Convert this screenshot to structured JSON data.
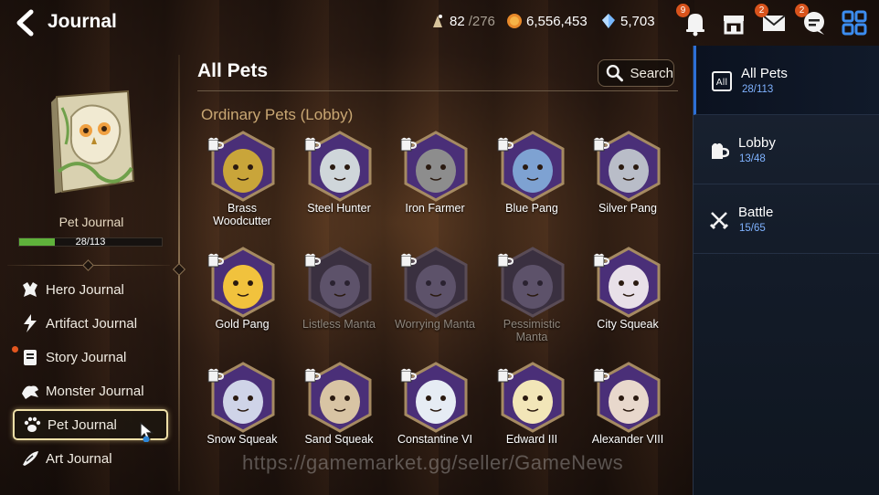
{
  "header": {
    "title": "Journal",
    "stamina": {
      "current": "82",
      "max": "/276"
    },
    "gold": "6,556,453",
    "crystals": "5,703",
    "notifications_badge": "9",
    "mail_badge": "2",
    "chat_badge": "2"
  },
  "left": {
    "book_label": "Pet Journal",
    "progress_text": "28/113",
    "progress_fraction": 0.248,
    "menu": [
      {
        "label": "Hero Journal",
        "icon": "hero-icon",
        "active": false,
        "dot": false
      },
      {
        "label": "Artifact Journal",
        "icon": "artifact-icon",
        "active": false,
        "dot": false
      },
      {
        "label": "Story Journal",
        "icon": "story-icon",
        "active": false,
        "dot": true
      },
      {
        "label": "Monster Journal",
        "icon": "monster-icon",
        "active": false,
        "dot": false
      },
      {
        "label": "Pet Journal",
        "icon": "paw-icon",
        "active": true,
        "dot": false
      },
      {
        "label": "Art Journal",
        "icon": "art-icon",
        "active": false,
        "dot": false
      }
    ]
  },
  "main": {
    "title": "All Pets",
    "search_label": "Search",
    "section_title": "Ordinary Pets (Lobby)",
    "pets": [
      {
        "name": "Brass\nWoodcutter",
        "locked": false,
        "color": "#c9a53a"
      },
      {
        "name": "Steel Hunter",
        "locked": false,
        "color": "#cfd6da"
      },
      {
        "name": "Iron Farmer",
        "locked": false,
        "color": "#8d8d8d"
      },
      {
        "name": "Blue Pang",
        "locked": false,
        "color": "#7ea2d2"
      },
      {
        "name": "Silver Pang",
        "locked": false,
        "color": "#b9bdc8"
      },
      {
        "name": "Gold Pang",
        "locked": false,
        "color": "#f1c23d"
      },
      {
        "name": "Listless Manta",
        "locked": true,
        "color": "#6a5e78"
      },
      {
        "name": "Worrying Manta",
        "locked": true,
        "color": "#6a5e78"
      },
      {
        "name": "Pessimistic\nManta",
        "locked": true,
        "color": "#6a5e78"
      },
      {
        "name": "City Squeak",
        "locked": false,
        "color": "#e8e0e8"
      },
      {
        "name": "Snow Squeak",
        "locked": false,
        "color": "#cfd4e8"
      },
      {
        "name": "Sand Squeak",
        "locked": false,
        "color": "#d8c4a4"
      },
      {
        "name": "Constantine VI",
        "locked": false,
        "color": "#e6ecf4"
      },
      {
        "name": "Edward III",
        "locked": false,
        "color": "#f2e6b8"
      },
      {
        "name": "Alexander VIII",
        "locked": false,
        "color": "#e8d8cc"
      }
    ]
  },
  "right": {
    "categories": [
      {
        "name": "All Pets",
        "count": "28/113",
        "icon": "all-icon",
        "active": true
      },
      {
        "name": "Lobby",
        "count": "13/48",
        "icon": "lobby-icon",
        "active": false
      },
      {
        "name": "Battle",
        "count": "15/65",
        "icon": "swords-icon",
        "active": false
      }
    ]
  },
  "watermark": "https://gamemarket.gg/seller/GameNews",
  "colors": {
    "accent_blue": "#2d6fd6",
    "progress_green": "#5fb23b",
    "gold_text": "#c9a773",
    "badge_orange": "#d8531c"
  }
}
